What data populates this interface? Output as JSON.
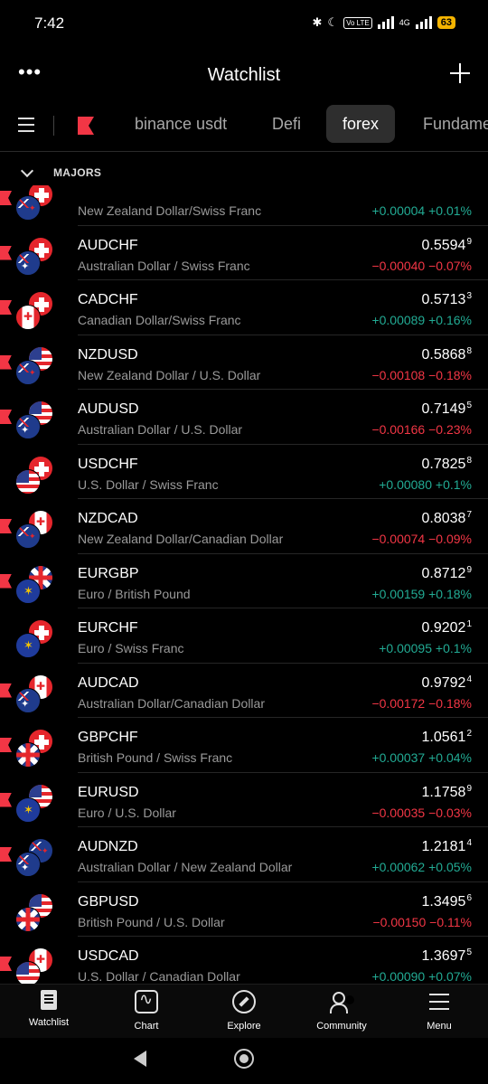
{
  "status_bar": {
    "time": "7:42",
    "volte": "Vo LTE",
    "network": "4G",
    "battery": "63"
  },
  "header": {
    "title": "Watchlist"
  },
  "tabs": [
    {
      "label": "binance usdt",
      "active": false
    },
    {
      "label": "Defi",
      "active": false
    },
    {
      "label": "forex",
      "active": true
    },
    {
      "label": "Fundame",
      "active": false
    }
  ],
  "section": {
    "label": "MAJORS"
  },
  "rows": [
    {
      "symbol": "",
      "description": "New Zealand Dollar/Swiss Franc",
      "price": "",
      "price_sup": "",
      "change": "+0.00004",
      "change_pct": "+0.01%",
      "direction": "pos",
      "flag_back": "chf",
      "flag_front": "nzd",
      "flagged": true
    },
    {
      "symbol": "AUDCHF",
      "description": "Australian Dollar / Swiss Franc",
      "price": "0.5594",
      "price_sup": "9",
      "change": "−0.00040",
      "change_pct": "−0.07%",
      "direction": "neg",
      "flag_back": "chf",
      "flag_front": "aus",
      "flagged": true
    },
    {
      "symbol": "CADCHF",
      "description": "Canadian Dollar/Swiss Franc",
      "price": "0.5713",
      "price_sup": "3",
      "change": "+0.00089",
      "change_pct": "+0.16%",
      "direction": "pos",
      "flag_back": "chf",
      "flag_front": "cad",
      "flagged": true
    },
    {
      "symbol": "NZDUSD",
      "description": "New Zealand Dollar / U.S. Dollar",
      "price": "0.5868",
      "price_sup": "8",
      "change": "−0.00108",
      "change_pct": "−0.18%",
      "direction": "neg",
      "flag_back": "usd",
      "flag_front": "nzd",
      "flagged": true
    },
    {
      "symbol": "AUDUSD",
      "description": "Australian Dollar / U.S. Dollar",
      "price": "0.7149",
      "price_sup": "5",
      "change": "−0.00166",
      "change_pct": "−0.23%",
      "direction": "neg",
      "flag_back": "usd",
      "flag_front": "aus",
      "flagged": true
    },
    {
      "symbol": "USDCHF",
      "description": "U.S. Dollar / Swiss Franc",
      "price": "0.7825",
      "price_sup": "8",
      "change": "+0.00080",
      "change_pct": "+0.1%",
      "direction": "pos",
      "flag_back": "chf",
      "flag_front": "usd",
      "flagged": false
    },
    {
      "symbol": "NZDCAD",
      "description": "New Zealand Dollar/Canadian Dollar",
      "price": "0.8038",
      "price_sup": "7",
      "change": "−0.00074",
      "change_pct": "−0.09%",
      "direction": "neg",
      "flag_back": "cad",
      "flag_front": "nzd",
      "flagged": true
    },
    {
      "symbol": "EURGBP",
      "description": "Euro / British Pound",
      "price": "0.8712",
      "price_sup": "9",
      "change": "+0.00159",
      "change_pct": "+0.18%",
      "direction": "pos",
      "flag_back": "gbp",
      "flag_front": "eur",
      "flagged": true
    },
    {
      "symbol": "EURCHF",
      "description": "Euro / Swiss Franc",
      "price": "0.9202",
      "price_sup": "1",
      "change": "+0.00095",
      "change_pct": "+0.1%",
      "direction": "pos",
      "flag_back": "chf",
      "flag_front": "eur",
      "flagged": false
    },
    {
      "symbol": "AUDCAD",
      "description": "Australian Dollar/Canadian Dollar",
      "price": "0.9792",
      "price_sup": "4",
      "change": "−0.00172",
      "change_pct": "−0.18%",
      "direction": "neg",
      "flag_back": "cad",
      "flag_front": "aus",
      "flagged": true
    },
    {
      "symbol": "GBPCHF",
      "description": "British Pound / Swiss Franc",
      "price": "1.0561",
      "price_sup": "2",
      "change": "+0.00037",
      "change_pct": "+0.04%",
      "direction": "pos",
      "flag_back": "chf",
      "flag_front": "gbp",
      "flagged": true
    },
    {
      "symbol": "EURUSD",
      "description": "Euro / U.S. Dollar",
      "price": "1.1758",
      "price_sup": "9",
      "change": "−0.00035",
      "change_pct": "−0.03%",
      "direction": "neg",
      "flag_back": "usd",
      "flag_front": "eur",
      "flagged": true
    },
    {
      "symbol": "AUDNZD",
      "description": "Australian Dollar / New Zealand Dollar",
      "price": "1.2181",
      "price_sup": "4",
      "change": "+0.00062",
      "change_pct": "+0.05%",
      "direction": "pos",
      "flag_back": "nzd",
      "flag_front": "aus",
      "flagged": true
    },
    {
      "symbol": "GBPUSD",
      "description": "British Pound / U.S. Dollar",
      "price": "1.3495",
      "price_sup": "6",
      "change": "−0.00150",
      "change_pct": "−0.11%",
      "direction": "neg",
      "flag_back": "usd",
      "flag_front": "gbp",
      "flagged": false
    },
    {
      "symbol": "USDCAD",
      "description": "U.S. Dollar / Canadian Dollar",
      "price": "1.3697",
      "price_sup": "5",
      "change": "+0.00090",
      "change_pct": "+0.07%",
      "direction": "pos",
      "flag_back": "cad",
      "flag_front": "usd",
      "flagged": true
    }
  ],
  "bottom_nav": [
    {
      "label": "Watchlist",
      "icon": "watchlist-icon"
    },
    {
      "label": "Chart",
      "icon": "chart-icon"
    },
    {
      "label": "Explore",
      "icon": "explore-icon"
    },
    {
      "label": "Community",
      "icon": "community-icon"
    },
    {
      "label": "Menu",
      "icon": "menu-icon"
    }
  ],
  "colors": {
    "positive": "#22ab94",
    "negative": "#f23645",
    "background": "#000000",
    "active_tab": "#2e2e2e",
    "brand_flag": "#f23645"
  }
}
